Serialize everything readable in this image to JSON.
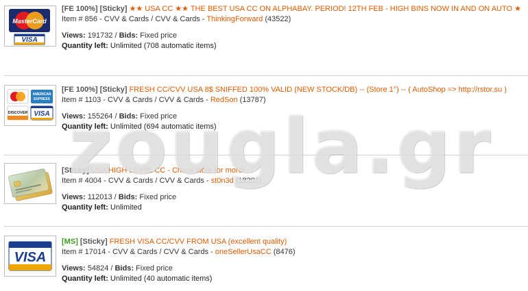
{
  "watermark": "zougla.gr",
  "listings": [
    {
      "tag_prefix": "[FE 100%]",
      "tag_sticky": "[Sticky]",
      "title": "★★ USA CC ★★ THE BEST USA CC ON ALPHABAY. PERIOD! 12TH FEB - HIGH BINS NOW IN AND ON AUTO ★",
      "item_prefix": "Item # 856 - CVV & Cards / CVV & Cards - ",
      "seller": "ThinkingForward",
      "seller_score": "(43522)",
      "views_label": "Views:",
      "views": "191732",
      "bids_label": "Bids:",
      "bids": "Fixed price",
      "qty_label": "Quantity left:",
      "qty": "Unlimited (708 automatic items)",
      "thumb_icon": "mastercard-visa-logo"
    },
    {
      "tag_prefix": "[FE 100%]",
      "tag_sticky": "[Sticky]",
      "title": "FRESH CC/CVV USA 8$ SNIFFED 100% VALID (NEW STOCK/DB) -- (Store 1°) -- ( AutoShop => http://rstor.su )",
      "item_prefix": "Item # 1103 - CVV & Cards / CVV & Cards - ",
      "seller": "RedSon",
      "seller_score": "(13787)",
      "views_label": "Views:",
      "views": "155264",
      "bids_label": "Bids:",
      "bids": "Fixed price",
      "qty_label": "Quantity left:",
      "qty": "Unlimited (694 automatic items)",
      "thumb_icon": "card-brands-logo"
    },
    {
      "tag_prefix": "",
      "tag_sticky": "[Sticky]",
      "title": "USA HIGH LEVEL CC - Check store for more!",
      "item_prefix": "Item # 4004 - CVV & Cards / CVV & Cards - ",
      "seller": "st0n3d",
      "seller_score": "(18202)",
      "views_label": "Views:",
      "views": "112013",
      "bids_label": "Bids:",
      "bids": "Fixed price",
      "qty_label": "Quantity left:",
      "qty": "Unlimited",
      "thumb_icon": "credit-card-photo"
    },
    {
      "tag_prefix": "[MS]",
      "tag_sticky": "[Sticky]",
      "title": "FRESH VISA CC/CVV FROM USA (excellent quality)",
      "item_prefix": "Item # 17014 - CVV & Cards / CVV & Cards - ",
      "seller": "oneSellerUsaCC",
      "seller_score": "(8476)",
      "views_label": "Views:",
      "views": "54824",
      "bids_label": "Bids:",
      "bids": "Fixed price",
      "qty_label": "Quantity left:",
      "qty": "Unlimited (40 automatic items)",
      "thumb_icon": "visa-logo"
    }
  ],
  "logo_text": {
    "mastercard": "MasterCard",
    "visa": "VISA",
    "amex_top": "AMERICAN",
    "amex_bottom": "EXPRESS",
    "discover": "DISCOVER"
  }
}
